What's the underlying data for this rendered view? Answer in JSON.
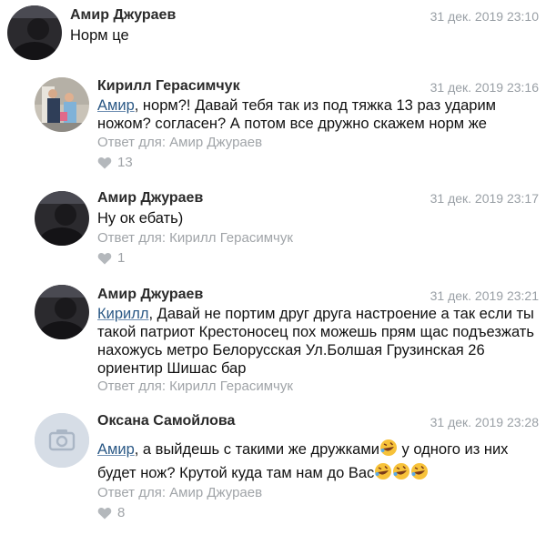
{
  "comments": [
    {
      "author": "Амир Джураев",
      "date": "31 дек. 2019 23:10",
      "text": "Норм це"
    },
    {
      "author": "Кирилл Герасимчук",
      "date": "31 дек. 2019 23:16",
      "mention": "Амир",
      "text_line1_rest": ", норм?! Давай тебя так из под тяжка 13 раз ударим",
      "text_line2": "ножом? согласен? А потом все дружно скажем норм же",
      "reply_to": "Ответ для: Амир Джураев",
      "likes": "13"
    },
    {
      "author": "Амир Джураев",
      "date": "31 дек. 2019 23:17",
      "text": "Ну ок ебать)",
      "reply_to": "Ответ для: Кирилл Герасимчук",
      "likes": "1"
    },
    {
      "author": "Амир Джураев",
      "date": "31 дек. 2019 23:21",
      "mention": "Кирилл",
      "text_line1_rest": ", Давай не портим друг друга настроение а так если ты",
      "text_line2": "такой патриот Крестоносец пох можешь прям щас подъезжать",
      "text_line3": "нахожусь метро Белорусская Ул.Болшая Грузинская 26",
      "text_line4": "ориентир Шишас бар",
      "reply_to": "Ответ для: Кирилл Герасимчук"
    },
    {
      "author": "Оксана Самойлова",
      "date": "31 дек. 2019 23:28",
      "mention": "Амир",
      "text_line1_rest": ", а выйдешь с такими же дружками",
      "text_line1_end": " у одного из них",
      "text_line2": "будет нож? Крутой куда там нам до Вас",
      "reply_to": "Ответ для: Амир Джураев",
      "likes": "8"
    }
  ],
  "icons": {
    "like": "heart-icon",
    "camera": "camera-icon",
    "emoji": "rolling-on-floor-laughing-emoji"
  },
  "colors": {
    "mention": "#2a5885",
    "meta": "#a0a4a8",
    "date": "#9aa0a6"
  }
}
